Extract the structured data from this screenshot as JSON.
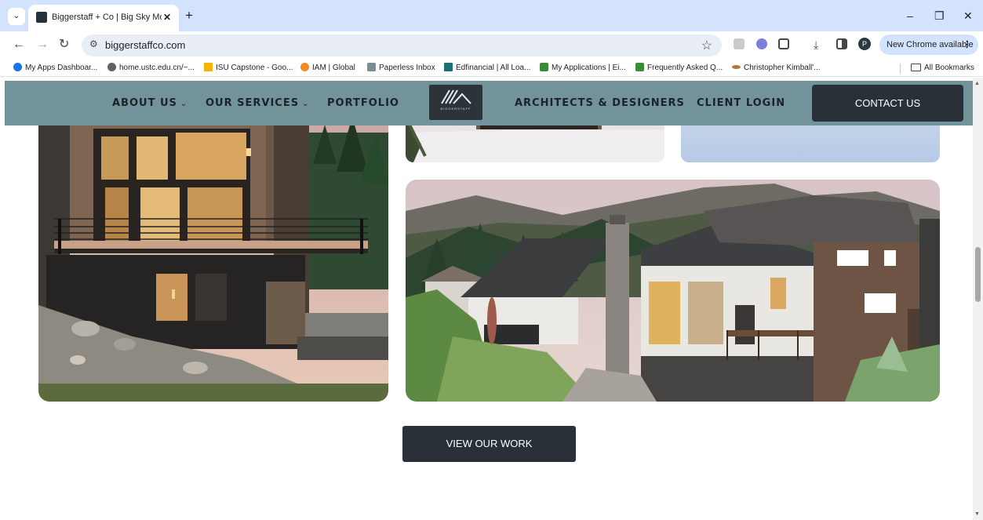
{
  "browser": {
    "tab_title": "Biggerstaff + Co | Big Sky Mont",
    "tab_close": "✕",
    "tab_search": "⌄",
    "new_tab": "+",
    "minimize": "–",
    "restore": "❐",
    "close": "✕",
    "back": "←",
    "forward": "→",
    "reload": "↻",
    "site_info": "⚙",
    "url": "biggerstaffco.com",
    "bookmark_star": "☆",
    "profile_initial": "P",
    "new_chrome_label": "New Chrome available",
    "menu_dots": "⋮",
    "bookmarks": [
      {
        "label": "My Apps Dashboar...",
        "color": "#1a73e8"
      },
      {
        "label": "home.ustc.edu.cn/~...",
        "color": "#5f6368"
      },
      {
        "label": "ISU Capstone - Goo...",
        "color": "#f4b400"
      },
      {
        "label": "IAM | Global",
        "color": "#f28b25"
      },
      {
        "label": "Paperless Inbox",
        "color": "#7c8c95"
      },
      {
        "label": "Edfinancial | All Loa...",
        "color": "#1e6f73"
      },
      {
        "label": "My Applications | Ei...",
        "color": "#3d8b37"
      },
      {
        "label": "Frequently Asked Q...",
        "color": "#3d8b37"
      },
      {
        "label": "Christopher Kimball'...",
        "color": "#b0763b"
      }
    ],
    "all_bookmarks": "All Bookmarks"
  },
  "site": {
    "nav": {
      "about": "ABOUT US",
      "services": "OUR SERVICES",
      "portfolio": "PORTFOLIO",
      "architects": "ARCHITECTS & DESIGNERS",
      "client_login": "CLIENT LOGIN",
      "contact": "CONTACT US",
      "caret": "⌄",
      "logo_text": "BIGGERSTAFF"
    },
    "view_work": "VIEW OUR WORK"
  },
  "colors": {
    "nav_bg": "#72939a",
    "button_bg": "#2a3037",
    "chrome_bg": "#d3e3fd"
  }
}
